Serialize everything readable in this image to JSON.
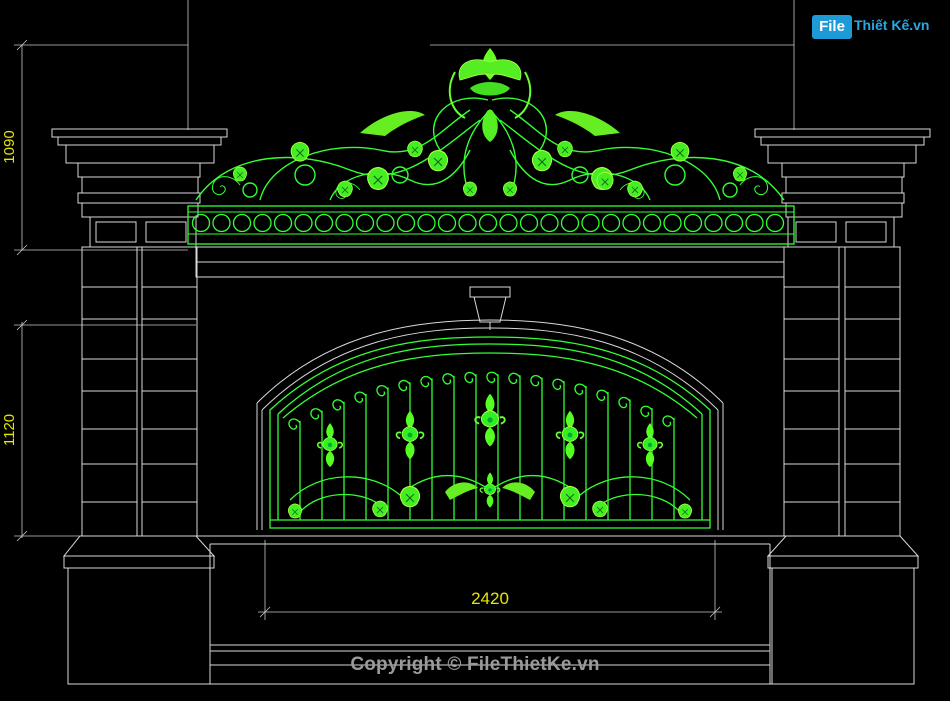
{
  "watermark": {
    "logo_file": "File",
    "logo_rest": "Thiết Kế.vn",
    "copyright": "Copyright © FileThietKe.vn"
  },
  "dimensions": {
    "top_height": "1090",
    "lower_height": "1120",
    "gate_width": "2420"
  },
  "colors": {
    "outline": "#d9d9d9",
    "ornament": "#33ff33",
    "ornament_bright": "#7dff3a",
    "dim_line": "#c8c8c8",
    "dim_text": "#e6e600",
    "guide": "#bfbfbf"
  }
}
